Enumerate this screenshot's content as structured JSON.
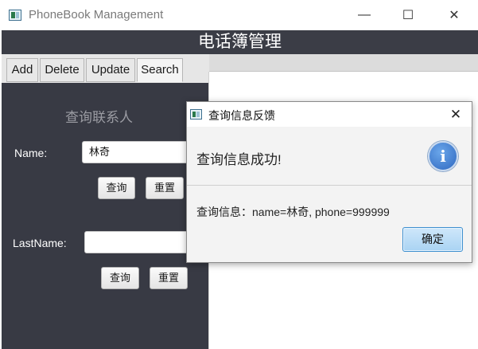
{
  "window": {
    "title": "PhoneBook Management",
    "minimize_glyph": "—",
    "maximize_glyph": "☐",
    "close_glyph": "✕"
  },
  "header": {
    "title": "电话簿管理"
  },
  "tabs": [
    {
      "label": "Add",
      "active": false
    },
    {
      "label": "Delete",
      "active": false
    },
    {
      "label": "Update",
      "active": false
    },
    {
      "label": "Search",
      "active": true
    }
  ],
  "search_panel": {
    "title": "查询联系人",
    "name_label": "Name:",
    "name_value": "林奇",
    "query_label": "查询",
    "reset_label": "重置",
    "lastname_label": "LastName:",
    "lastname_value": "",
    "query2_label": "查询",
    "reset2_label": "重置"
  },
  "dialog": {
    "title": "查询信息反馈",
    "close_glyph": "✕",
    "header_text": "查询信息成功!",
    "icon_glyph": "i",
    "body_text": "查询信息：name=林奇, phone=999999",
    "ok_label": "确定"
  }
}
